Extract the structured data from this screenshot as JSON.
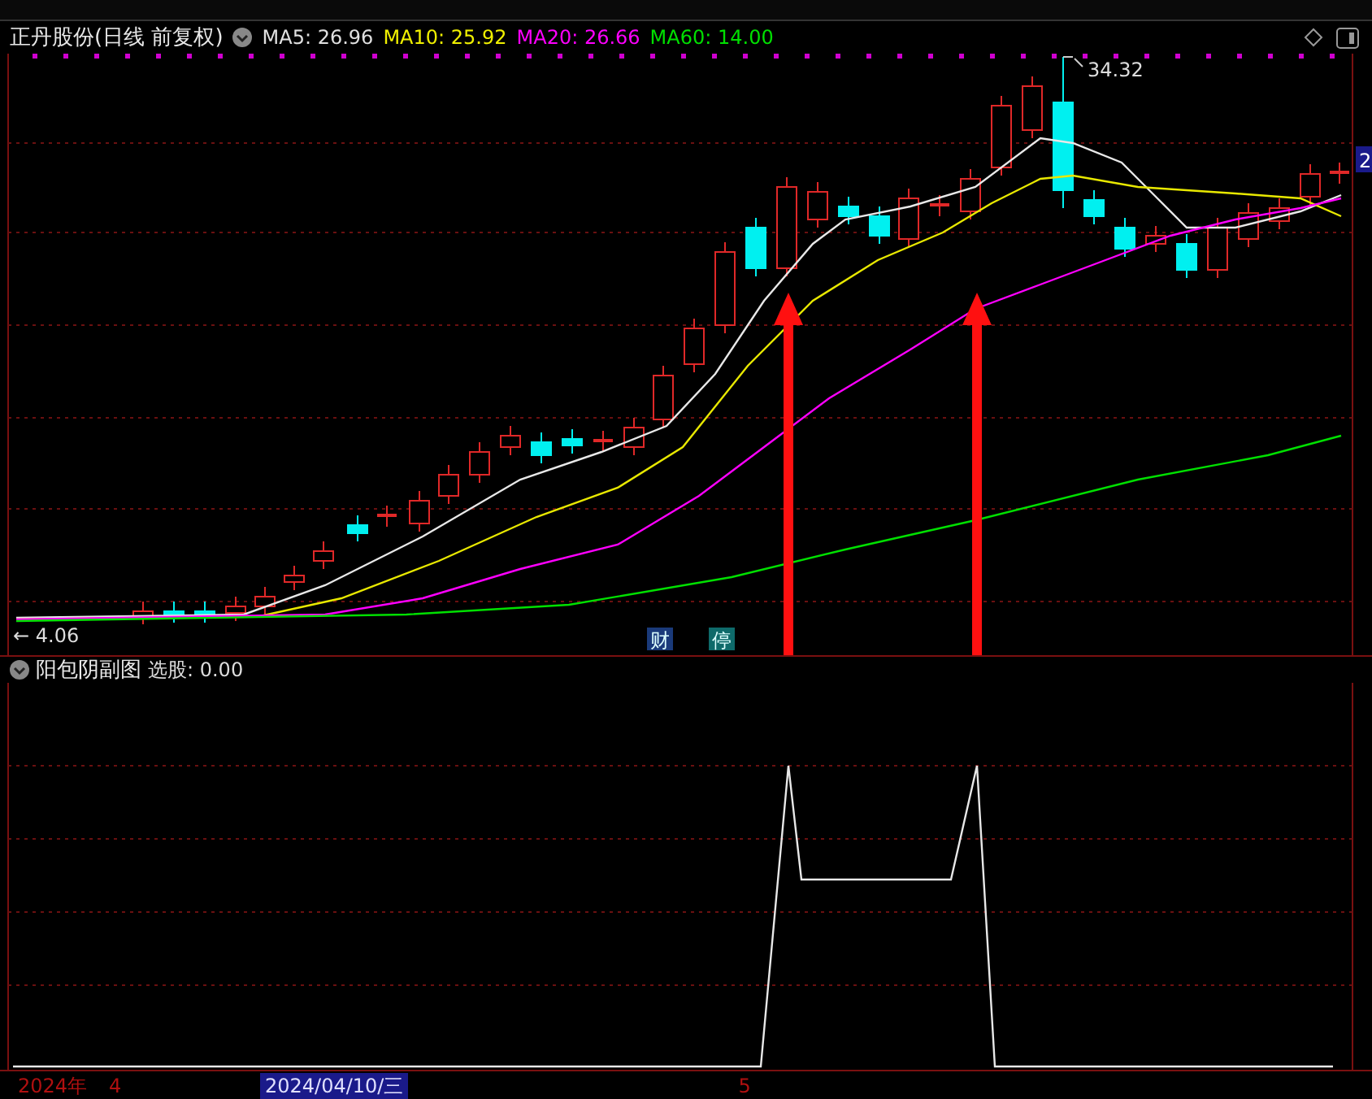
{
  "main_header": {
    "title": "正丹股份(日线 前复权)",
    "indicators": [
      {
        "label": "MA5: 26.96",
        "color": "#e0e0e0"
      },
      {
        "label": "MA10: 25.92",
        "color": "#f0f000"
      },
      {
        "label": "MA20: 26.66",
        "color": "#ff00ff"
      },
      {
        "label": "MA60: 14.00",
        "color": "#00e000"
      }
    ]
  },
  "main_chart": {
    "high_label": "34.32",
    "low_label": "← 4.06",
    "price_tag": "2",
    "event_markers": [
      {
        "label": "财",
        "color": "#1a3a7a"
      },
      {
        "label": "停",
        "color": "#0e6a6a"
      }
    ]
  },
  "sub_header": {
    "title": "阳包阴副图",
    "reading": "选股: 0.00"
  },
  "time_axis": [
    {
      "label": "2024年",
      "selected": false
    },
    {
      "label": "4",
      "selected": false
    },
    {
      "label": "2024/04/10/三",
      "selected": true
    },
    {
      "label": "5",
      "selected": false
    }
  ]
}
